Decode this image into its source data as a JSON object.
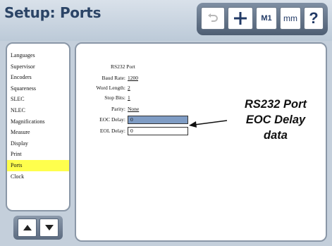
{
  "header": {
    "title": "Setup: Ports"
  },
  "toolbar": {
    "m1_label": "M1",
    "mm_label": "mm",
    "help_label": "?"
  },
  "sidebar": {
    "items": [
      {
        "label": "Languages"
      },
      {
        "label": "Supervisor"
      },
      {
        "label": "Encoders"
      },
      {
        "label": "Squareness"
      },
      {
        "label": "SLEC"
      },
      {
        "label": "NLEC"
      },
      {
        "label": "Magnifications"
      },
      {
        "label": "Measure"
      },
      {
        "label": "Display"
      },
      {
        "label": "Print"
      },
      {
        "label": "Ports",
        "active": true
      },
      {
        "label": "Clock"
      }
    ]
  },
  "form": {
    "section_label": "RS232 Port",
    "baud_label": "Baud Rate:",
    "baud_value": "1200",
    "word_label": "Word Length:",
    "word_value": "2",
    "stop_label": "Stop Bits:",
    "stop_value": "1",
    "parity_label": "Parity:",
    "parity_value": "None",
    "eoc_label": "EOC Delay:",
    "eoc_value": "0",
    "eol_label": "EOL Delay:",
    "eol_value": "0"
  },
  "callout": {
    "line1": "RS232 Port",
    "line2": "EOC Delay",
    "line3": "data"
  },
  "colors": {
    "accent": "#2b4466",
    "active_item": "#ffff4d",
    "selected_field": "#7f9cc4"
  }
}
